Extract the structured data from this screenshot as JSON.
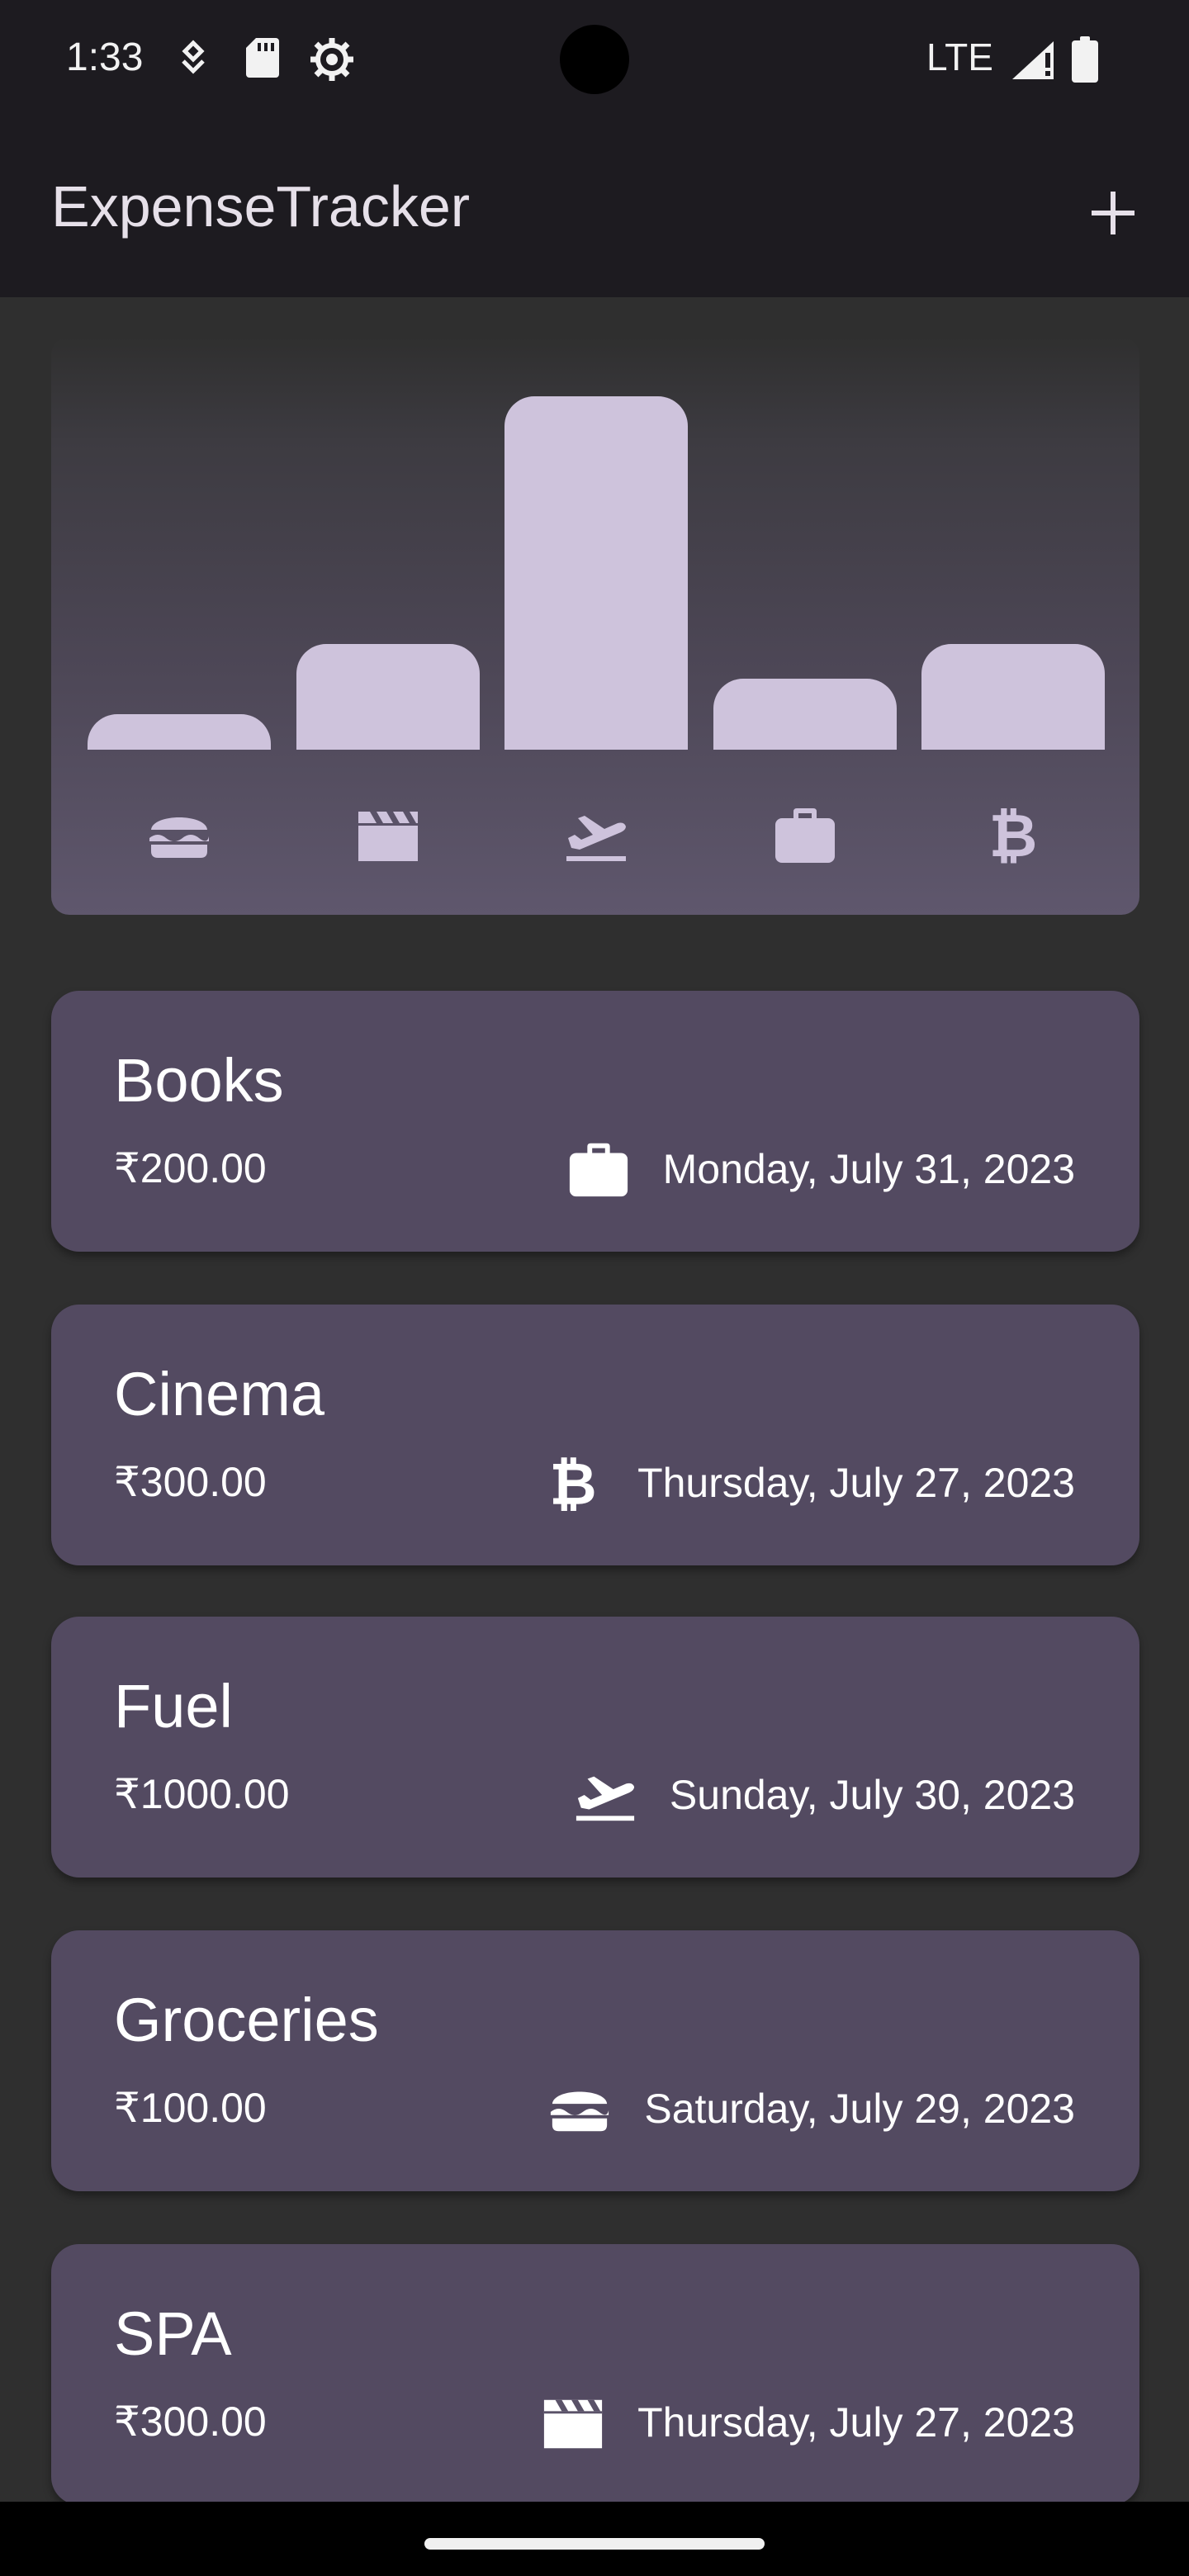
{
  "status_bar": {
    "time": "1:33",
    "network": "LTE"
  },
  "app_bar": {
    "title": "ExpenseTracker",
    "add_icon": "plus-icon"
  },
  "chart_data": {
    "type": "bar",
    "categories": [
      "food",
      "leisure",
      "travel",
      "work",
      "other"
    ],
    "category_icons": [
      "burger-icon",
      "movie-clapper-icon",
      "flight-takeoff-icon",
      "briefcase-icon",
      "bitcoin-icon"
    ],
    "values": [
      100,
      300,
      1000,
      200,
      300
    ],
    "ylim": [
      0,
      1000
    ],
    "bar_color": "#cec3dc"
  },
  "expenses": [
    {
      "title": "Books",
      "amount": "₹200.00",
      "date": "Monday, July 31, 2023",
      "icon": "briefcase-icon"
    },
    {
      "title": "Cinema",
      "amount": "₹300.00",
      "date": "Thursday, July 27, 2023",
      "icon": "bitcoin-icon"
    },
    {
      "title": "Fuel",
      "amount": "₹1000.00",
      "date": "Sunday, July 30, 2023",
      "icon": "flight-takeoff-icon"
    },
    {
      "title": "Groceries",
      "amount": "₹100.00",
      "date": "Saturday, July 29, 2023",
      "icon": "burger-icon"
    },
    {
      "title": "SPA",
      "amount": "₹300.00",
      "date": "Thursday, July 27, 2023",
      "icon": "movie-clapper-icon"
    }
  ],
  "colors": {
    "card": "#534a61",
    "background": "#2f2f2f",
    "app_bar": "#1d1b20",
    "accent": "#cec3dc"
  }
}
